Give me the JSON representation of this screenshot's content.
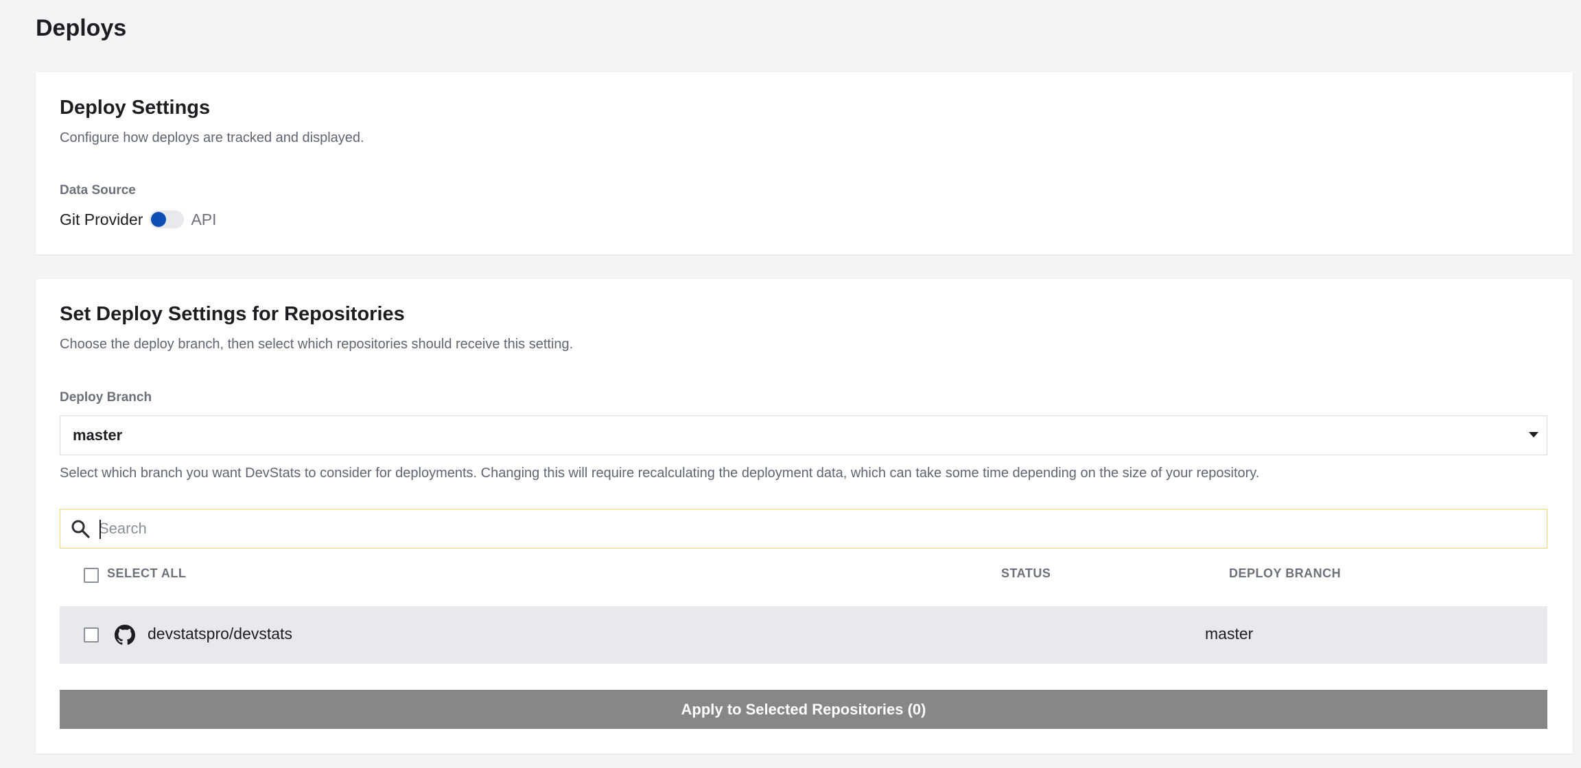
{
  "page": {
    "title": "Deploys"
  },
  "deploy_settings": {
    "title": "Deploy Settings",
    "subtitle": "Configure how deploys are tracked and displayed.",
    "data_source_label": "Data Source",
    "toggle_left": "Git Provider",
    "toggle_right": "API",
    "toggle_state": "Git Provider",
    "accent_color": "#0d4fb5"
  },
  "repo_settings": {
    "title": "Set Deploy Settings for Repositories",
    "subtitle": "Choose the deploy branch, then select which repositories should receive this setting.",
    "branch_label": "Deploy Branch",
    "branch_value": "master",
    "branch_help": "Select which branch you want DevStats to consider for deployments. Changing this will require recalculating the deployment data, which can take some time depending on the size of your repository.",
    "search": {
      "placeholder": "Search",
      "value": "",
      "icon": "search-icon"
    },
    "table": {
      "columns": [
        "SELECT ALL",
        "STATUS",
        "DEPLOY BRANCH"
      ],
      "rows": [
        {
          "icon": "github-icon",
          "name": "devstatspro/devstats",
          "status": "",
          "deploy_branch": "master",
          "selected": false
        }
      ]
    },
    "apply_button": "Apply to Selected Repositories (0)"
  }
}
